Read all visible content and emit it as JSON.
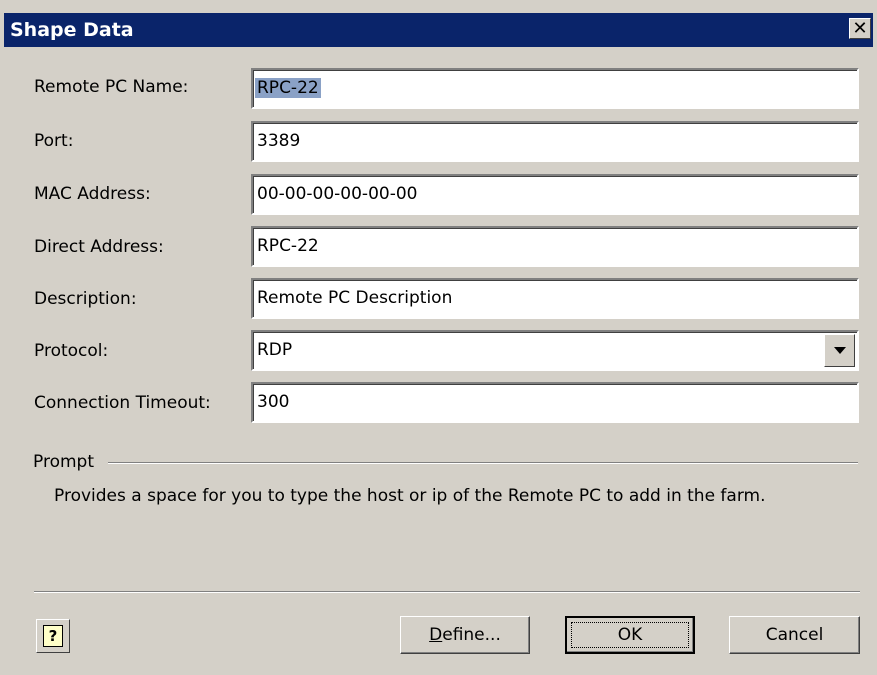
{
  "window": {
    "title": "Shape Data"
  },
  "fields": [
    {
      "label": "Remote PC Name:",
      "value": "RPC-22"
    },
    {
      "label": "Port:",
      "value": "3389"
    },
    {
      "label": "MAC Address:",
      "value": "00-00-00-00-00-00"
    },
    {
      "label": "Direct Address:",
      "value": "RPC-22"
    },
    {
      "label": "Description:",
      "value": "Remote PC Description"
    },
    {
      "label": "Protocol:",
      "value": "RDP"
    },
    {
      "label": "Connection Timeout:",
      "value": "300"
    }
  ],
  "prompt": {
    "label": "Prompt",
    "text": "Provides a space for you to type the host or ip of the Remote PC to add in the farm."
  },
  "buttons": {
    "help": "?",
    "define_mnemonic": "D",
    "define_rest": "efine...",
    "ok": "OK",
    "cancel": "Cancel"
  },
  "colors": {
    "titlebar": "#0a246a",
    "face": "#d4d0c8",
    "selection": "#8aa1c6"
  }
}
